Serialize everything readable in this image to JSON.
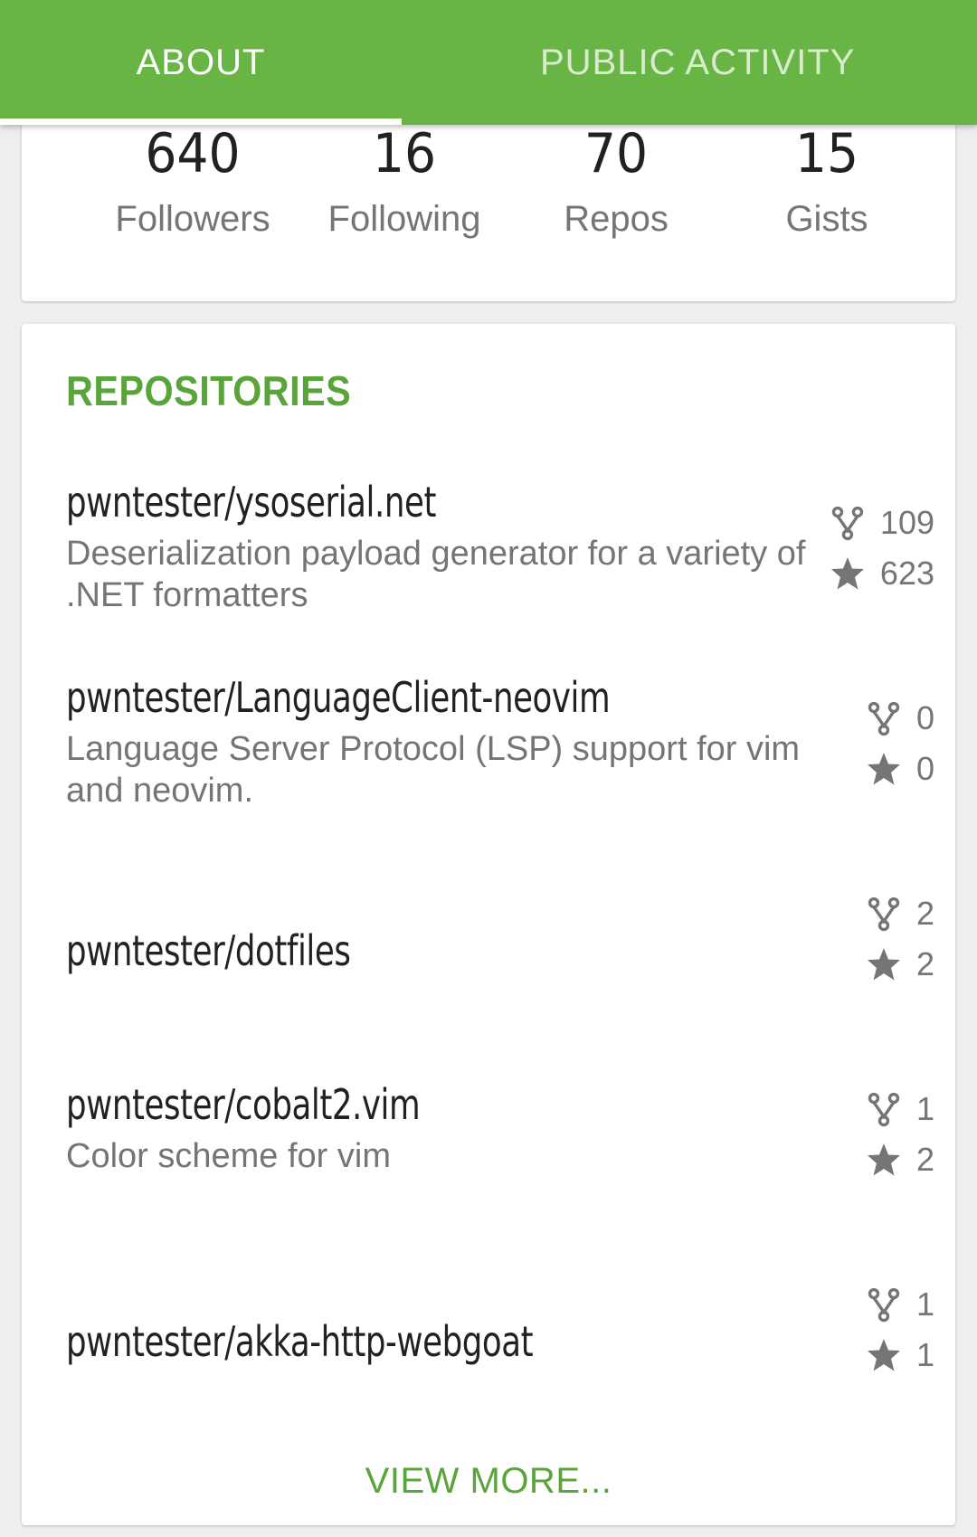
{
  "tabs": [
    {
      "label": "ABOUT",
      "active": true
    },
    {
      "label": "PUBLIC ACTIVITY",
      "active": false
    }
  ],
  "stats": [
    {
      "value": "640",
      "label": "Followers"
    },
    {
      "value": "16",
      "label": "Following"
    },
    {
      "value": "70",
      "label": "Repos"
    },
    {
      "value": "15",
      "label": "Gists"
    }
  ],
  "repositories": {
    "title": "REPOSITORIES",
    "items": [
      {
        "name": "pwntester/ysoserial.net",
        "description": "Deserialization payload generator for a variety of .NET formatters",
        "forks": "109",
        "stars": "623"
      },
      {
        "name": "pwntester/LanguageClient-neovim",
        "description": "Language Server Protocol (LSP) support for vim and neovim.",
        "forks": "0",
        "stars": "0"
      },
      {
        "name": "pwntester/dotfiles",
        "description": "",
        "forks": "2",
        "stars": "2"
      },
      {
        "name": "pwntester/cobalt2.vim",
        "description": "Color scheme for vim",
        "forks": "1",
        "stars": "2"
      },
      {
        "name": "pwntester/akka-http-webgoat",
        "description": "",
        "forks": "1",
        "stars": "1"
      }
    ],
    "view_more": "VIEW MORE..."
  },
  "icons": {
    "fork": "fork-icon",
    "star": "star-icon"
  },
  "colors": {
    "accent": "#68b444",
    "accent_text": "#5aa53a",
    "primary_text": "#212121",
    "secondary_text": "#757575"
  }
}
